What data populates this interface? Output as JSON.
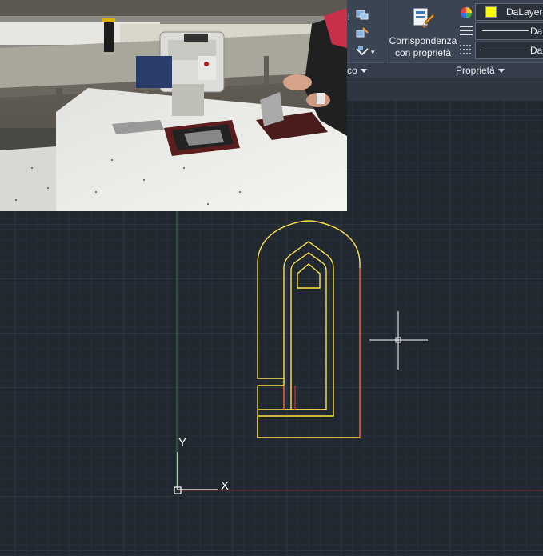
{
  "ribbon": {
    "left_panel_label": "co",
    "match_properties_label_line1": "Corrispondenza",
    "match_properties_label_line2": "con proprietà",
    "properties_panel_label": "Proprietà",
    "color_value": "DaLayer",
    "linetype_value": "Da",
    "lineweight_value": "Da",
    "colors": {
      "ribbon_bg": "#3b4453",
      "layer_color": "#ffff00"
    }
  },
  "canvas": {
    "ucs_y_label": "Y",
    "ucs_x_label": "X",
    "colors": {
      "background": "#212830",
      "grid_minor": "#2a3240",
      "grid_major": "#333c4b",
      "drawing_yellow": "#ffe14a",
      "drawing_red": "#ff3030",
      "y_axis": "#2f7a3a",
      "x_axis": "#7a2f2f"
    }
  },
  "video": {
    "description_icon": "sewing-machine-video"
  }
}
